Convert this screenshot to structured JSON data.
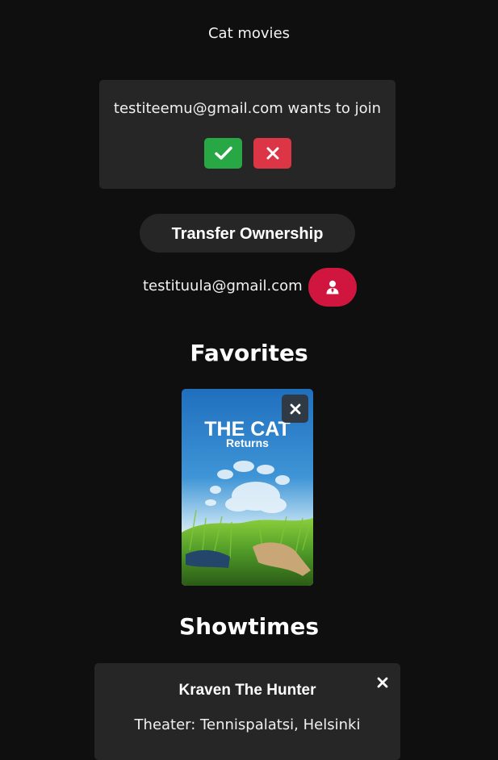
{
  "group": {
    "name": "Cat movies"
  },
  "join_request": {
    "text": "testiteemu@gmail.com wants to join",
    "accept_icon": "check-icon",
    "reject_icon": "close-icon",
    "accept_color": "#28a745",
    "reject_color": "#dc3545"
  },
  "ownership": {
    "transfer_label": "Transfer Ownership",
    "member_email": "testituula@gmail.com",
    "member_icon": "user-tie-icon",
    "member_button_color": "#d0163f"
  },
  "favorites": {
    "heading": "Favorites",
    "items": [
      {
        "title": "THE CAT",
        "subtitle": "Returns",
        "remove_icon": "close-icon"
      }
    ]
  },
  "showtimes": {
    "heading": "Showtimes",
    "items": [
      {
        "title": "Kraven The Hunter",
        "theater": "Theater: Tennispalatsi, Helsinki"
      }
    ]
  }
}
